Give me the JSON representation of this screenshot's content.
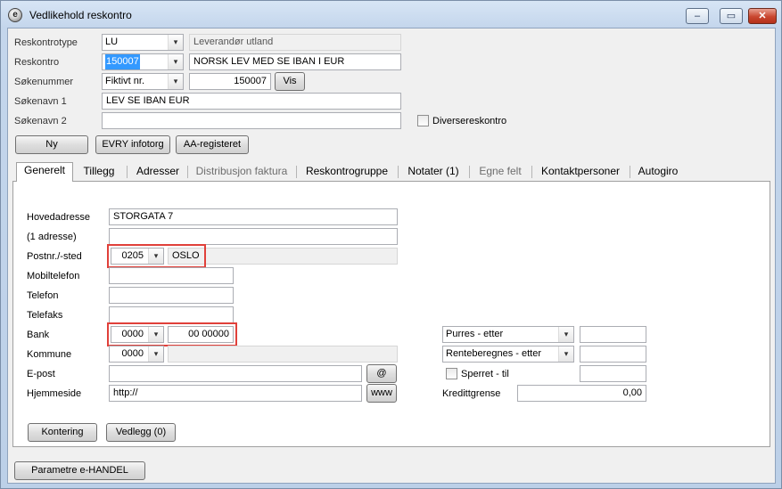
{
  "window": {
    "title": "Vedlikehold reskontro",
    "icon_glyph": "e",
    "app_icon": "app-logo-icon",
    "controls": {
      "minimize": "minimize-icon",
      "maximize": "maximize-icon",
      "close": "close-icon"
    },
    "control_glyphs": {
      "minimize": "–",
      "maximize": "▭",
      "close": "✕"
    }
  },
  "header": {
    "reskontrotype": {
      "label": "Reskontrotype",
      "code": "LU",
      "description": "Leverandør utland"
    },
    "reskontro": {
      "label": "Reskontro",
      "number": "150007",
      "name": "NORSK LEV MED SE IBAN I EUR"
    },
    "sokenummer": {
      "label": "Søkenummer",
      "type": "Fiktivt nr.",
      "value": "150007",
      "button": "Vis"
    },
    "sokenavn1": {
      "label": "Søkenavn 1",
      "value": "LEV SE IBAN EUR"
    },
    "sokenavn2": {
      "label": "Søkenavn 2",
      "value": ""
    },
    "diverse": {
      "label": "Diversereskontro",
      "checked": false
    },
    "buttons": {
      "ny": "Ny",
      "evry": "EVRY infotorg",
      "aa": "AA-registeret"
    }
  },
  "tabs": [
    {
      "label": "Generelt",
      "active": true,
      "enabled": true
    },
    {
      "label": "Tillegg",
      "active": false,
      "enabled": true
    },
    {
      "label": "Adresser",
      "active": false,
      "enabled": true
    },
    {
      "label": "Distribusjon faktura",
      "active": false,
      "enabled": false
    },
    {
      "label": "Reskontrogruppe",
      "active": false,
      "enabled": true
    },
    {
      "label": "Notater (1)",
      "active": false,
      "enabled": true
    },
    {
      "label": "Egne felt",
      "active": false,
      "enabled": false
    },
    {
      "label": "Kontaktpersoner",
      "active": false,
      "enabled": true
    },
    {
      "label": "Autogiro",
      "active": false,
      "enabled": true
    }
  ],
  "general": {
    "hovedadresse": {
      "label": "Hovedadresse",
      "value": "STORGATA 7"
    },
    "adresse1": {
      "label": "(1 adresse)",
      "value": ""
    },
    "postnr": {
      "label": "Postnr./-sted",
      "code": "0205",
      "place": "OSLO"
    },
    "mobil": {
      "label": "Mobiltelefon",
      "value": ""
    },
    "telefon": {
      "label": "Telefon",
      "value": ""
    },
    "telefaks": {
      "label": "Telefaks",
      "value": ""
    },
    "bank": {
      "label": "Bank",
      "code": "0000",
      "account": "00 00000"
    },
    "kommune": {
      "label": "Kommune",
      "code": "0000",
      "name": ""
    },
    "epost": {
      "label": "E-post",
      "value": "",
      "button": "@"
    },
    "hjemmeside": {
      "label": "Hjemmeside",
      "value": "http://",
      "button": "www"
    },
    "purres": {
      "label": "Purres - etter",
      "value": ""
    },
    "renteberegnes": {
      "label": "Renteberegnes - etter",
      "value": ""
    },
    "sperret": {
      "label": "Sperret  -  til",
      "checked": false,
      "value": ""
    },
    "kredittgrense": {
      "label": "Kredittgrense",
      "value": "0,00"
    },
    "buttons": {
      "kontering": "Kontering",
      "vedlegg": "Vedlegg (0)"
    }
  },
  "footer": {
    "parametre": "Parametre e-HANDEL"
  },
  "icons": {
    "dropdown": "dropdown-arrow-icon",
    "arrow_glyph": "▾"
  },
  "colors": {
    "highlight": "#e0403a",
    "selection": "#3399ff"
  }
}
